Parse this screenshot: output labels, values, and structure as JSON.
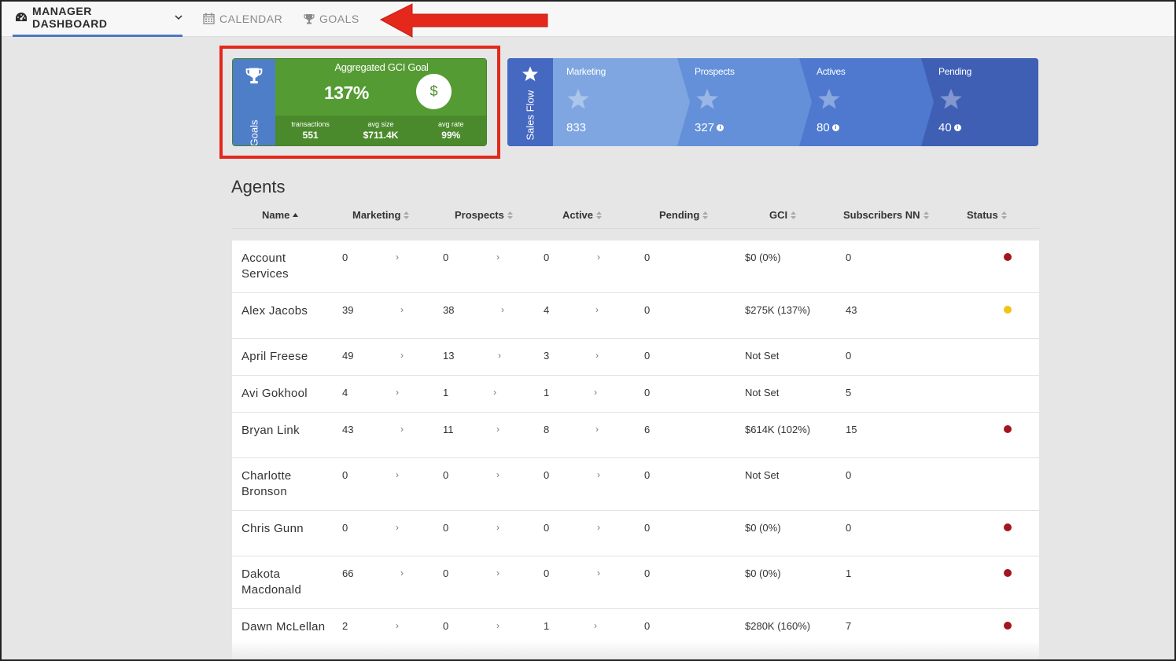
{
  "nav": {
    "manager_label": "MANAGER DASHBOARD",
    "calendar_label": "CALENDAR",
    "goals_label": "GOALS"
  },
  "goals_card": {
    "side_label": "Goals",
    "title": "Aggregated GCI Goal",
    "percent": "137%",
    "dollar_symbol": "$",
    "stats": [
      {
        "label": "transactions",
        "value": "551"
      },
      {
        "label": "avg size",
        "value": "$711.4K"
      },
      {
        "label": "avg rate",
        "value": "99%"
      }
    ]
  },
  "sales_flow": {
    "side_label": "Sales Flow",
    "stages": [
      {
        "label": "Marketing",
        "value": "833",
        "info": false,
        "color": "#7fa6e0"
      },
      {
        "label": "Prospects",
        "value": "327",
        "info": true,
        "color": "#6490da"
      },
      {
        "label": "Actives",
        "value": "80",
        "info": true,
        "color": "#4e79cf"
      },
      {
        "label": "Pending",
        "value": "40",
        "info": true,
        "color": "#3f5fb5"
      }
    ]
  },
  "agents": {
    "title": "Agents",
    "columns": [
      "Name",
      "Marketing",
      "Prospects",
      "Active",
      "Pending",
      "GCI",
      "Subscribers NN",
      "Status"
    ],
    "rows": [
      {
        "name": "Account Services",
        "marketing": "0",
        "prospects": "0",
        "active": "0",
        "pending": "0",
        "gci": "$0 (0%)",
        "subscribers": "0",
        "status": "red"
      },
      {
        "name": "Alex Jacobs",
        "marketing": "39",
        "prospects": "38",
        "active": "4",
        "pending": "0",
        "gci": "$275K (137%)",
        "subscribers": "43",
        "status": "yellow"
      },
      {
        "name": "April Freese",
        "marketing": "49",
        "prospects": "13",
        "active": "3",
        "pending": "0",
        "gci": "Not Set",
        "subscribers": "0",
        "status": "none"
      },
      {
        "name": "Avi Gokhool",
        "marketing": "4",
        "prospects": "1",
        "active": "1",
        "pending": "0",
        "gci": "Not Set",
        "subscribers": "5",
        "status": "none"
      },
      {
        "name": "Bryan Link",
        "marketing": "43",
        "prospects": "11",
        "active": "8",
        "pending": "6",
        "gci": "$614K (102%)",
        "subscribers": "15",
        "status": "red"
      },
      {
        "name": "Charlotte Bronson",
        "marketing": "0",
        "prospects": "0",
        "active": "0",
        "pending": "0",
        "gci": "Not Set",
        "subscribers": "0",
        "status": "none"
      },
      {
        "name": "Chris Gunn",
        "marketing": "0",
        "prospects": "0",
        "active": "0",
        "pending": "0",
        "gci": "$0 (0%)",
        "subscribers": "0",
        "status": "red"
      },
      {
        "name": "Dakota Macdonald",
        "marketing": "66",
        "prospects": "0",
        "active": "0",
        "pending": "0",
        "gci": "$0 (0%)",
        "subscribers": "1",
        "status": "red"
      },
      {
        "name": "Dawn McLellan",
        "marketing": "2",
        "prospects": "0",
        "active": "1",
        "pending": "0",
        "gci": "$280K (160%)",
        "subscribers": "7",
        "status": "red"
      }
    ]
  },
  "colors": {
    "status_red": "#a3161f",
    "status_yellow": "#f2c414",
    "goal_green": "#559b33",
    "highlight_red": "#e5281c",
    "nav_accent": "#4a78c2"
  }
}
